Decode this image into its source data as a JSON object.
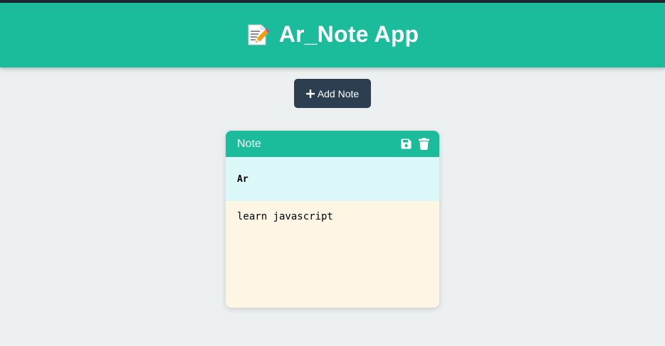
{
  "header": {
    "icon": "memo-icon",
    "title": "Ar_Note App",
    "background": "#1abc9c"
  },
  "toolbar": {
    "add_icon": "plus-icon",
    "add_label": "Add Note",
    "button_color": "#2c3e50"
  },
  "notes": [
    {
      "label": "Note",
      "save_icon": "floppy-disk-icon",
      "delete_icon": "trash-icon",
      "title": "Ar",
      "body": "learn javascript",
      "title_bg": "#dcf8f8",
      "body_bg": "#fef6e4"
    }
  ]
}
